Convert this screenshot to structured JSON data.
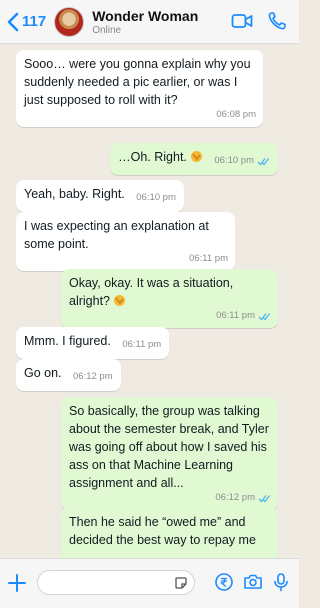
{
  "header": {
    "back_count": "117",
    "contact_name": "Wonder Woman",
    "contact_status": "Online",
    "icons": [
      "video-call-icon",
      "phone-call-icon"
    ]
  },
  "messages": [
    {
      "dir": "in",
      "text": "Sooo… were you gonna explain why you suddenly needed a pic earlier, or was I just supposed to roll with it?",
      "time": "06:08 pm"
    },
    {
      "dir": "out",
      "text": "…Oh. Right.",
      "emoji": "face-palm-emoji",
      "time": "06:10 pm",
      "read": true
    },
    {
      "dir": "in",
      "text": "Yeah, baby. Right.",
      "time": "06:10 pm"
    },
    {
      "dir": "in",
      "text": "I was expecting an explanation at some point.",
      "time": "06:11 pm"
    },
    {
      "dir": "out",
      "text": "Okay, okay. It was a situation, alright?",
      "emoji": "face-palm-emoji",
      "time": "06:11 pm",
      "read": true
    },
    {
      "dir": "in",
      "text": "Mmm. I figured.",
      "time": "06:11 pm"
    },
    {
      "dir": "in",
      "text": "Go on.",
      "time": "06:12 pm"
    },
    {
      "dir": "out",
      "text": "So basically, the group was talking about the semester break, and Tyler was going off about how I saved his ass on that Machine Learning assignment and all...",
      "time": "06:12 pm",
      "read": true
    },
    {
      "dir": "out",
      "text": "Then he said he “owed me” and decided the best way to repay me",
      "time": "",
      "read": false
    }
  ],
  "composer": {
    "placeholder": "",
    "icons": [
      "plus-icon",
      "sticker-icon",
      "rupee-payment-icon",
      "camera-icon",
      "microphone-icon"
    ]
  },
  "colors": {
    "accent": "#1a8cff",
    "outgoing_bubble": "#e1f9d2",
    "incoming_bubble": "#ffffff",
    "chat_background": "#efeae2",
    "read_ticks": "#4fb6ec"
  }
}
